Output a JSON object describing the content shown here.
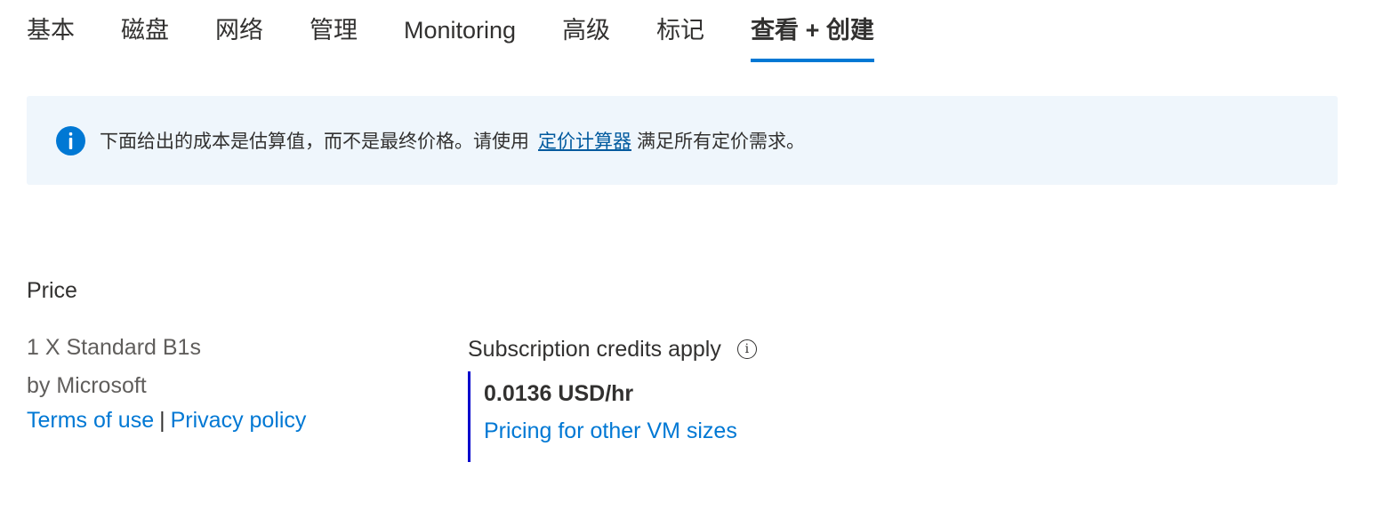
{
  "tabs": [
    {
      "label": "基本",
      "active": false
    },
    {
      "label": "磁盘",
      "active": false
    },
    {
      "label": "网络",
      "active": false
    },
    {
      "label": "管理",
      "active": false
    },
    {
      "label": "Monitoring",
      "active": false
    },
    {
      "label": "高级",
      "active": false
    },
    {
      "label": "标记",
      "active": false
    },
    {
      "label": "查看 + 创建",
      "active": true
    }
  ],
  "banner": {
    "icon": "info-icon",
    "text_before": "下面给出的成本是估算值，而不是最终价格。请使用",
    "link": "定价计算器",
    "text_after": "满足所有定价需求。"
  },
  "price": {
    "title": "Price",
    "product": "1 X Standard B1s",
    "publisher": "by Microsoft",
    "terms_link": "Terms of use",
    "separator": "|",
    "privacy_link": "Privacy policy",
    "credits_label": "Subscription credits apply",
    "credits_icon": "info-outline-icon",
    "amount": "0.0136 USD/hr",
    "other_sizes_link": "Pricing for other VM sizes"
  },
  "colors": {
    "accent": "#0078d4",
    "banner_bg": "#eff6fc",
    "price_bar": "#0000cc"
  }
}
